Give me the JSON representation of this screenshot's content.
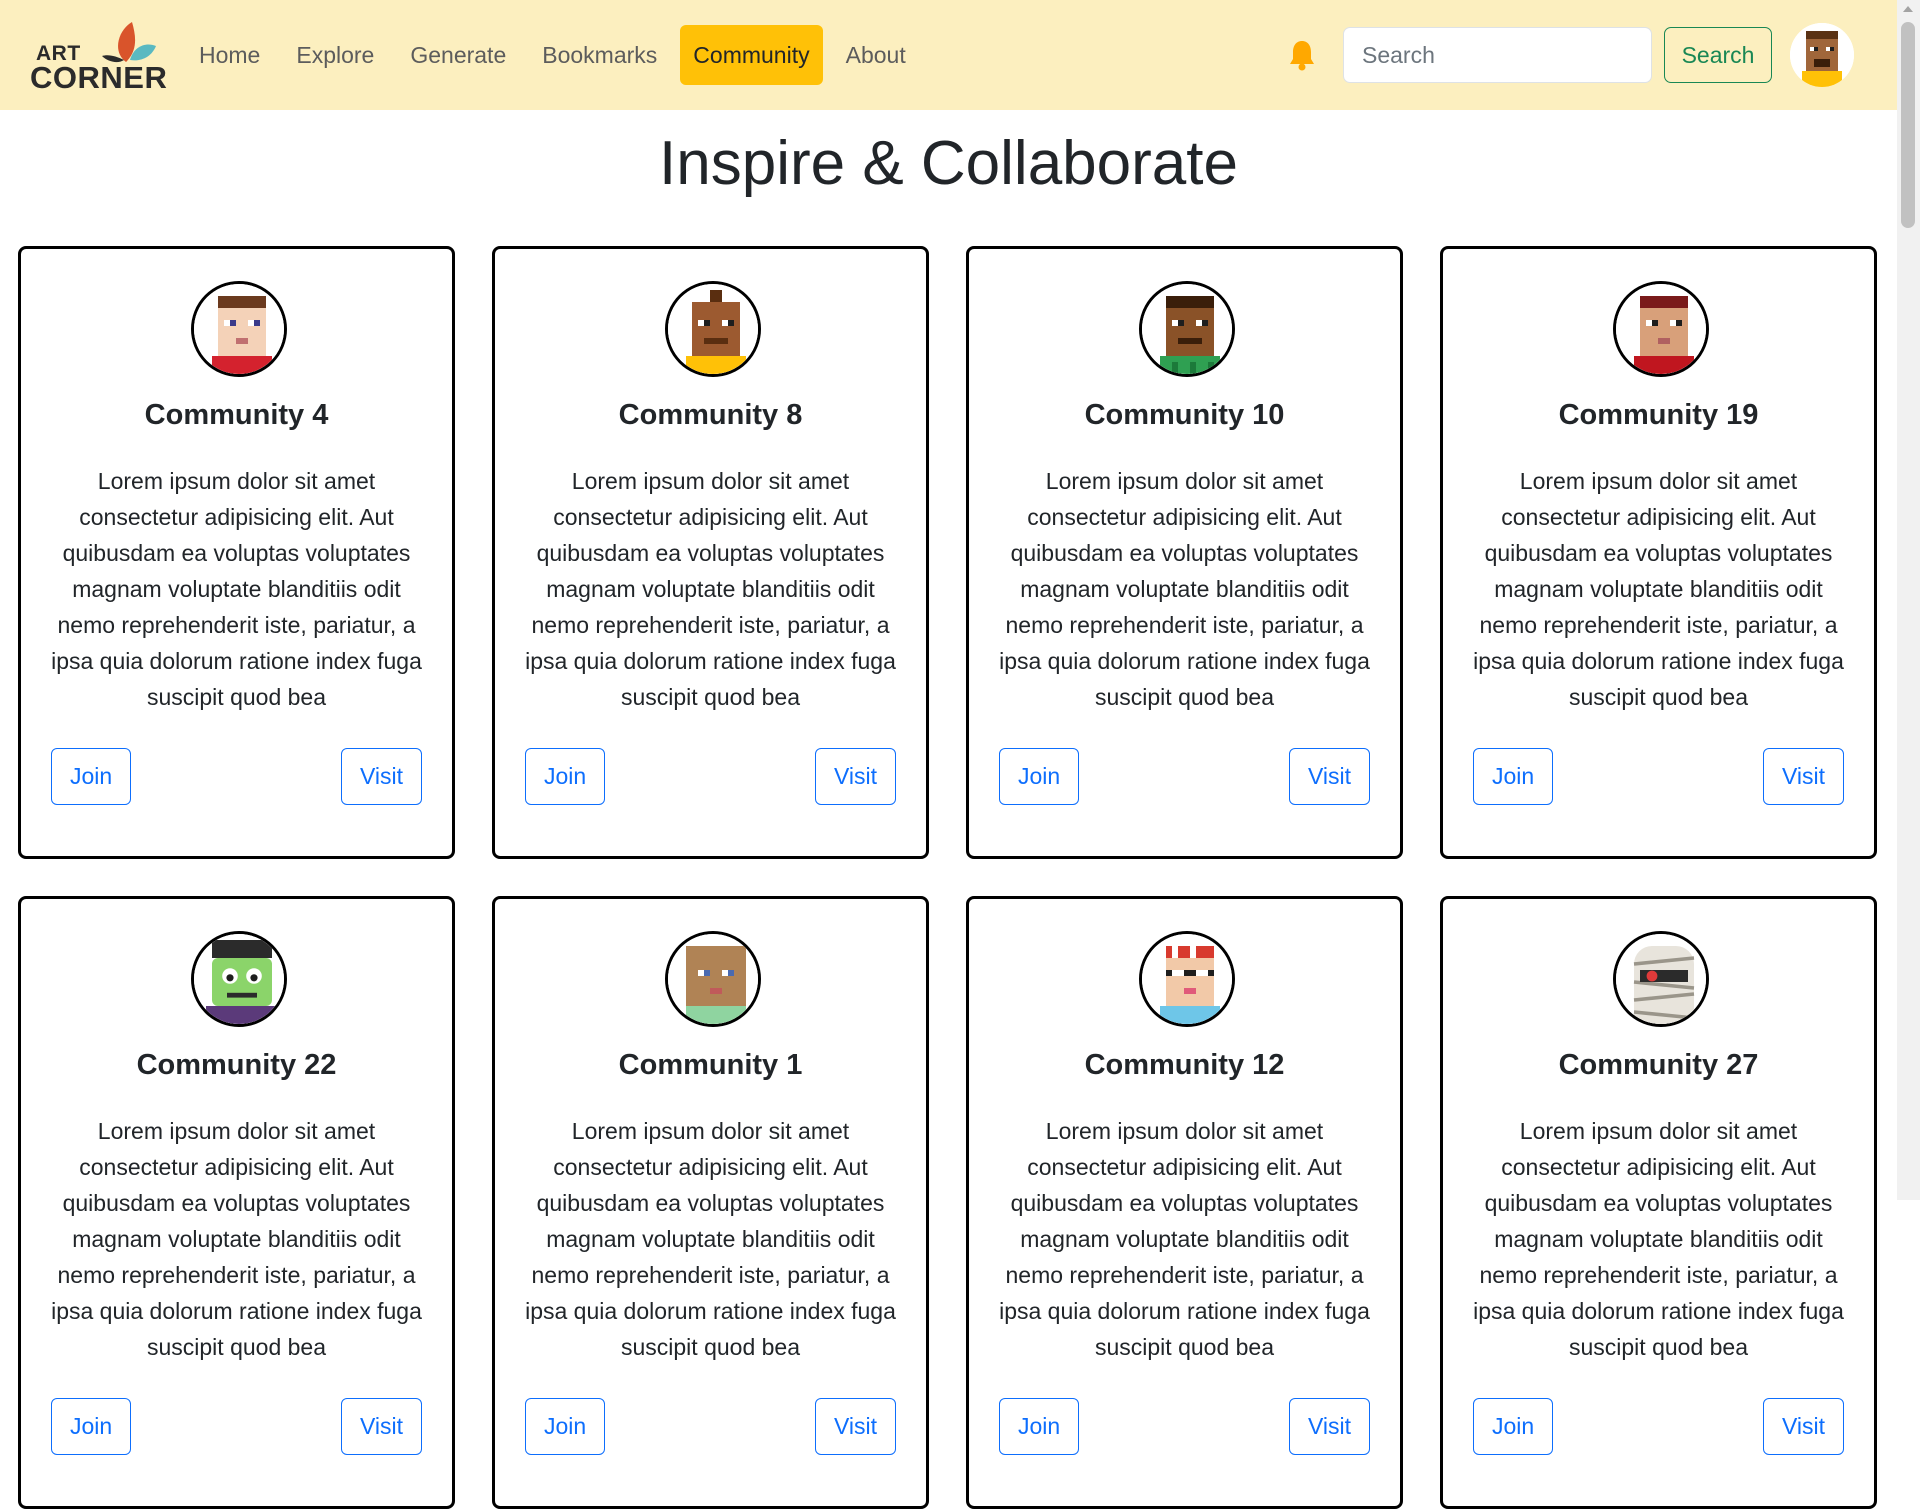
{
  "app": {
    "logo_line1": "ART",
    "logo_line2": "CORNER"
  },
  "nav": {
    "items": [
      {
        "label": "Home",
        "active": false
      },
      {
        "label": "Explore",
        "active": false
      },
      {
        "label": "Generate",
        "active": false
      },
      {
        "label": "Bookmarks",
        "active": false
      },
      {
        "label": "Community",
        "active": true
      },
      {
        "label": "About",
        "active": false
      }
    ],
    "notification_icon": "bell-icon",
    "search_placeholder": "Search",
    "search_value": "",
    "search_button": "Search"
  },
  "page": {
    "title": "Inspire & Collaborate"
  },
  "communities": [
    {
      "name": "Community 4",
      "description": "Lorem ipsum dolor sit amet consectetur adipisicing elit. Aut quibusdam ea voluptas voluptates magnam voluptate blanditiis odit nemo reprehenderit iste, pariatur, a ipsa quia dolorum ratione index fuga suscipit quod bea",
      "join_label": "Join",
      "visit_label": "Visit"
    },
    {
      "name": "Community 8",
      "description": "Lorem ipsum dolor sit amet consectetur adipisicing elit. Aut quibusdam ea voluptas voluptates magnam voluptate blanditiis odit nemo reprehenderit iste, pariatur, a ipsa quia dolorum ratione index fuga suscipit quod bea",
      "join_label": "Join",
      "visit_label": "Visit"
    },
    {
      "name": "Community 10",
      "description": "Lorem ipsum dolor sit amet consectetur adipisicing elit. Aut quibusdam ea voluptas voluptates magnam voluptate blanditiis odit nemo reprehenderit iste, pariatur, a ipsa quia dolorum ratione index fuga suscipit quod bea",
      "join_label": "Join",
      "visit_label": "Visit"
    },
    {
      "name": "Community 19",
      "description": "Lorem ipsum dolor sit amet consectetur adipisicing elit. Aut quibusdam ea voluptas voluptates magnam voluptate blanditiis odit nemo reprehenderit iste, pariatur, a ipsa quia dolorum ratione index fuga suscipit quod bea",
      "join_label": "Join",
      "visit_label": "Visit"
    },
    {
      "name": "Community 22",
      "description": "Lorem ipsum dolor sit amet consectetur adipisicing elit. Aut quibusdam ea voluptas voluptates magnam voluptate blanditiis odit nemo reprehenderit iste, pariatur, a ipsa quia dolorum ratione index fuga suscipit quod bea",
      "join_label": "Join",
      "visit_label": "Visit"
    },
    {
      "name": "Community 1",
      "description": "Lorem ipsum dolor sit amet consectetur adipisicing elit. Aut quibusdam ea voluptas voluptates magnam voluptate blanditiis odit nemo reprehenderit iste, pariatur, a ipsa quia dolorum ratione index fuga suscipit quod bea",
      "join_label": "Join",
      "visit_label": "Visit"
    },
    {
      "name": "Community 12",
      "description": "Lorem ipsum dolor sit amet consectetur adipisicing elit. Aut quibusdam ea voluptas voluptates magnam voluptate blanditiis odit nemo reprehenderit iste, pariatur, a ipsa quia dolorum ratione index fuga suscipit quod bea",
      "join_label": "Join",
      "visit_label": "Visit"
    },
    {
      "name": "Community 27",
      "description": "Lorem ipsum dolor sit amet consectetur adipisicing elit. Aut quibusdam ea voluptas voluptates magnam voluptate blanditiis odit nemo reprehenderit iste, pariatur, a ipsa quia dolorum ratione index fuga suscipit quod bea",
      "join_label": "Join",
      "visit_label": "Visit"
    }
  ],
  "colors": {
    "navbar_bg": "#fcefbf",
    "active_nav": "#ffc107",
    "search_button": "#198754",
    "card_button": "#0d6efd"
  }
}
